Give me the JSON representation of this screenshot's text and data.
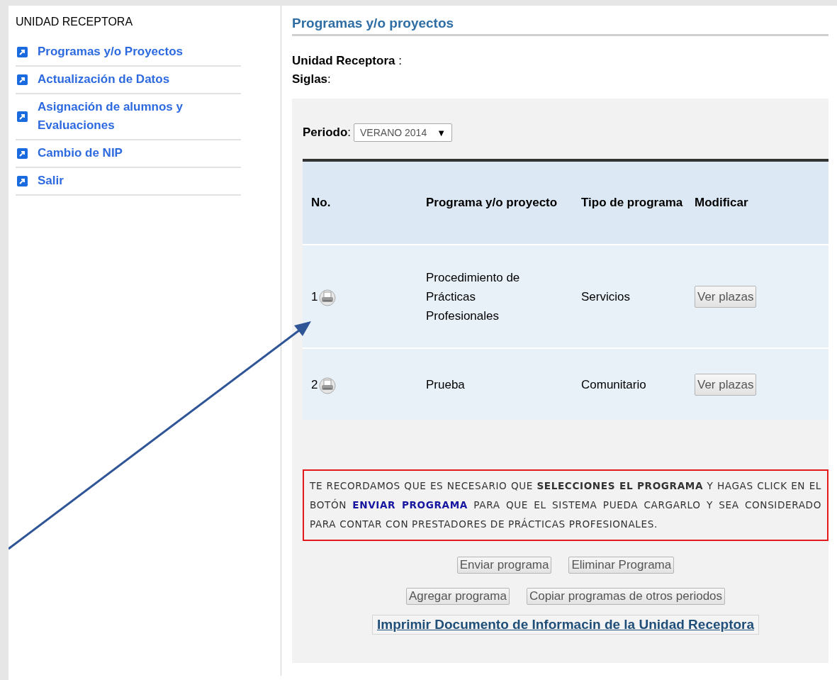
{
  "sidebar": {
    "title": "UNIDAD RECEPTORA",
    "items": [
      {
        "label": "Programas y/o Proyectos"
      },
      {
        "label": "Actualización de Datos"
      },
      {
        "label": "Asignación de alumnos y Evaluaciones"
      },
      {
        "label": "Cambio de NIP"
      },
      {
        "label": "Salir"
      }
    ]
  },
  "main": {
    "title": "Programas y/o proyectos",
    "fields": [
      "**Unidad Receptora** :",
      "**Siglas**:"
    ],
    "period": {
      "label": "**Periodo**:",
      "value": "VERANO 2014",
      "caret": "▼"
    },
    "table": {
      "columns": [
        "No.",
        "Programa y/o proyecto",
        "Tipo de programa",
        "Modificar"
      ],
      "rows": [
        {
          "no": "1",
          "program": "Procedimiento de Prácticas Profesionales",
          "type": "Servicios",
          "action": "Ver plazas"
        },
        {
          "no": "2",
          "program": "Prueba",
          "type": "Comunitario",
          "action": "Ver plazas"
        }
      ]
    },
    "notice": [
      {
        "kind": "normal",
        "text": "TE RECORDAMOS QUE ES NECESARIO QUE "
      },
      {
        "kind": "bold",
        "text": "SELECCIONES EL PROGRAMA"
      },
      {
        "kind": "normal",
        "text": " Y HAGAS CLICK EN EL BOTÓN "
      },
      {
        "kind": "highlight",
        "text": "ENVIAR PROGRAMA"
      },
      {
        "kind": "normal",
        "text": " PARA QUE EL SISTEMA PUEDA CARGARLO Y SEA CONSIDERADO PARA CONTAR CON PRESTADORES DE PRÁCTICAS PROFESIONALES."
      }
    ],
    "button_rows": [
      [
        "Enviar programa",
        "Eliminar Programa"
      ],
      [
        "Agregar programa",
        "Copiar programas de otros periodos"
      ]
    ],
    "print_link": "Imprimir Documento de Informacin de la Unidad Receptora"
  },
  "annotation": {
    "kind": "arrow"
  }
}
